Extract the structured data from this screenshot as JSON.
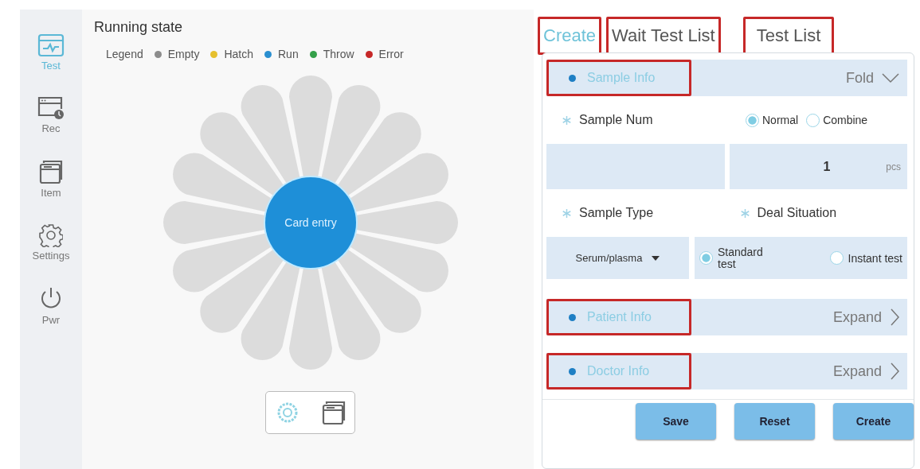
{
  "sidebar": {
    "items": [
      {
        "label": "Test",
        "kind": "test",
        "selected": true
      },
      {
        "label": "Rec",
        "kind": "record",
        "selected": false
      },
      {
        "label": "Item",
        "kind": "item",
        "selected": false
      },
      {
        "label": "Settings",
        "kind": "settings",
        "selected": false
      },
      {
        "label": "Pwr",
        "kind": "power",
        "selected": false
      }
    ]
  },
  "running_state": {
    "title": "Running state",
    "legend": {
      "label": "Legend",
      "items": [
        {
          "label": "Empty",
          "color": "#8c8c8c"
        },
        {
          "label": "Hatch",
          "color": "#e6c02e"
        },
        {
          "label": "Run",
          "color": "#2a8fd0"
        },
        {
          "label": "Throw",
          "color": "#34a049"
        },
        {
          "label": "Error",
          "color": "#c62828"
        }
      ]
    },
    "carousel": {
      "center_label": "Card entry",
      "slots": [
        {
          "color": "#dcdcdc"
        },
        {
          "color": "#dcdcdc"
        },
        {
          "color": "#dcdcdc"
        },
        {
          "color": "#dcdcdc"
        },
        {
          "color": "#dcdcdc"
        },
        {
          "color": "#dcdcdc"
        },
        {
          "color": "#dcdcdc"
        },
        {
          "color": "#dcdcdc"
        },
        {
          "color": "#dcdcdc"
        },
        {
          "color": "#dcdcdc"
        },
        {
          "color": "#dcdcdc"
        },
        {
          "color": "#dcdcdc"
        },
        {
          "color": "#dcdcdc"
        },
        {
          "color": "#dcdcdc"
        },
        {
          "color": "#dcdcdc"
        },
        {
          "color": "#dcdcdc"
        }
      ]
    },
    "view_switcher": [
      {
        "kind": "wheel",
        "selected": true
      },
      {
        "kind": "cards",
        "selected": false
      }
    ]
  },
  "panel": {
    "tabs": [
      {
        "label": "Create",
        "selected": true,
        "highlighted": true
      },
      {
        "label": "Wait Test List",
        "selected": false,
        "highlighted": true
      },
      {
        "label": "Test List",
        "selected": false,
        "highlighted": true
      }
    ],
    "sample_info": {
      "title": "Sample Info",
      "action": "Fold",
      "expanded": true,
      "highlighted": true,
      "num_label": "Sample Num",
      "num_required": true,
      "num_modes": [
        {
          "label": "Normal",
          "selected": true
        },
        {
          "label": "Combine",
          "selected": false
        }
      ],
      "count": "1",
      "unit": "pcs",
      "type_label": "Sample Type",
      "type_required": true,
      "deal_label": "Deal Situation",
      "deal_required": true,
      "type_value": "Serum/plasma",
      "deal_options": [
        {
          "label": "Standard test",
          "selected": true
        },
        {
          "label": "Instant test",
          "selected": false
        }
      ]
    },
    "sections": [
      {
        "title": "Patient Info",
        "action": "Expand",
        "expanded": false,
        "highlighted": true
      },
      {
        "title": "Doctor Info",
        "action": "Expand",
        "expanded": false,
        "highlighted": true
      }
    ],
    "buttons": [
      "Save",
      "Reset",
      "Create"
    ]
  }
}
